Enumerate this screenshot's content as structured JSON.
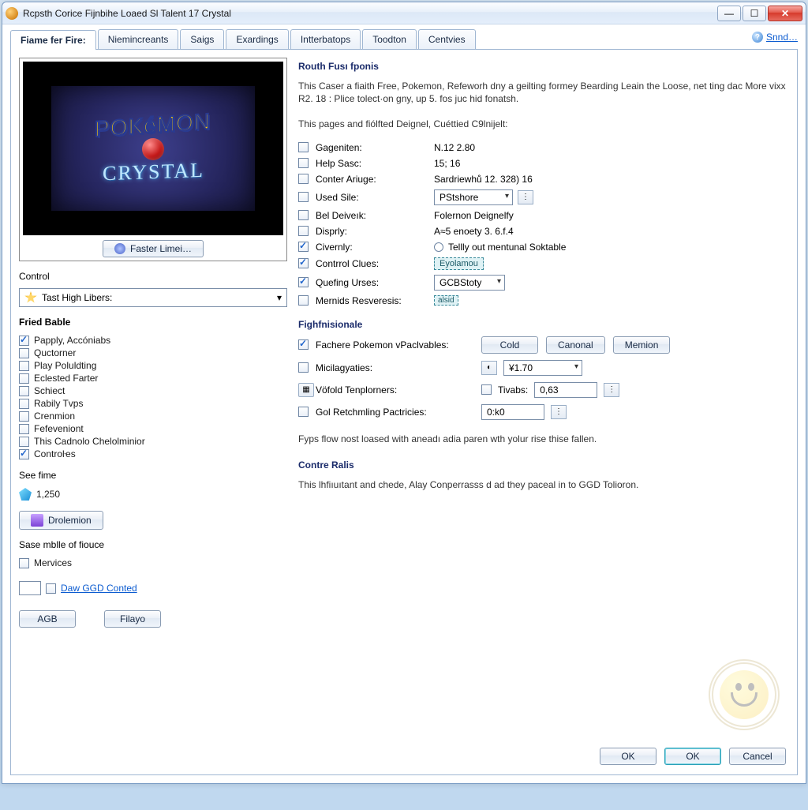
{
  "window": {
    "title": "Rcpsth Corice Fijnbihe Loaed Sl Talent 17 Crystal"
  },
  "toplink": {
    "label": "Snnd…"
  },
  "tabs": [
    "Fiame fer Fire:",
    "Niemincreants",
    "Saigs",
    "Exardings",
    "Intterbatops",
    "Toodton",
    "Centvies"
  ],
  "left": {
    "preview": {
      "line1": "POKéMON",
      "line2": "CRYSTAL"
    },
    "faster_btn": "Faster Limei…",
    "control_title": "Control",
    "control_select": "Tast High Libers:",
    "fried_title": "Fried Bable",
    "fried_items": [
      {
        "label": "Papply, Accóniabs",
        "checked": true
      },
      {
        "label": "Quctorner",
        "checked": false
      },
      {
        "label": "Play Poluldting",
        "checked": false
      },
      {
        "label": "Eclested Farter",
        "checked": false
      },
      {
        "label": "Schiect",
        "checked": false
      },
      {
        "label": "Rabily Tvps",
        "checked": false
      },
      {
        "label": "Crenmion",
        "checked": false
      },
      {
        "label": "Fefeveniont",
        "checked": false
      },
      {
        "label": "This Cadnolo Chelolminior",
        "checked": false
      },
      {
        "label": "Controŀes",
        "checked": true
      }
    ],
    "see_time_label": "See fime",
    "see_time_value": "1,250",
    "drolemion_btn": "Drolemion",
    "sase_title": "Sase mblle of fiouce",
    "mervices_label": "Mervices",
    "daw_link": "Daw GGD Conted",
    "agb_btn": "AGB",
    "filayo_btn": "Filayo"
  },
  "right": {
    "heading1": "Routh Fusı fponis",
    "desc1": "This Caser a fiaith Free, Pokemon, Refeworh dny a geilting formey Bearding Leain the Loose, net ting dac More vixx R2. 18 : Plice tolect·on gny, up 5. fos juc hid fonatsh.",
    "desc2": "This pages and fiólfted Deignel, Cuéttied C9lnijelt:",
    "props": [
      {
        "label": "Gageniten:",
        "value": "N.12 2.80",
        "checked": false,
        "type": "text"
      },
      {
        "label": "Help Sasc:",
        "value": "15; 16",
        "checked": false,
        "type": "text"
      },
      {
        "label": "Conter Ariuge:",
        "value": "Sardriewhů 12. 328) 16",
        "checked": false,
        "type": "text"
      },
      {
        "label": "Used Sile:",
        "value": "PStshore",
        "checked": false,
        "type": "select"
      },
      {
        "label": "Bel Deiveık:",
        "value": "Folernon Deignelfy",
        "checked": false,
        "type": "text"
      },
      {
        "label": "Disprly:",
        "value": "A≈5 enoety 3. 6.f.4",
        "checked": false,
        "type": "text"
      },
      {
        "label": "Civernly:",
        "value": "Tellly out mentunal Soktable",
        "checked": true,
        "type": "radio"
      },
      {
        "label": "Contrrol Clues:",
        "value": "Eyolamou",
        "checked": true,
        "type": "tag"
      },
      {
        "label": "Quefing Urses:",
        "value": "GCBStoty",
        "checked": true,
        "type": "select-sm"
      },
      {
        "label": "Mernids Resveresis:",
        "value": "alsid",
        "checked": false,
        "type": "tag-sm"
      }
    ],
    "heading2": "Fighfnisionale",
    "fachere": {
      "label": "Fachere Pokemon vPaclvables:",
      "checked": true,
      "btns": [
        "Cold",
        "Canonal",
        "Memion"
      ]
    },
    "micil": {
      "label": "Micilagyaties:",
      "checked": false,
      "sel_value": "¥1.70"
    },
    "vofold": {
      "label": "Vöfold Tenplorners:",
      "sub": "Tivabs:",
      "value": "0,63"
    },
    "gol": {
      "label": "Gol Retchmling Pactricies:",
      "value": "0:k0"
    },
    "note": "Fyps flow nost loased with aneadı adia paren wth yolur rise thise fallen.",
    "heading3": "Contre Ralis",
    "desc3": "This lhfiıuıtant and chede, Alay Conperrasss d ad they paceal in to GGD Tolioron."
  },
  "buttons": {
    "ok1": "OK",
    "ok2": "OK",
    "cancel": "Cancel"
  }
}
